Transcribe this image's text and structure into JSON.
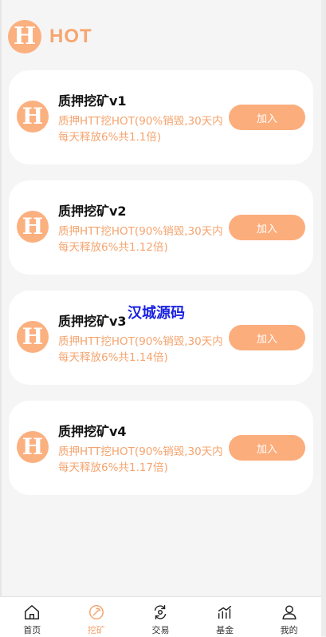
{
  "header": {
    "logo_letter": "H",
    "brand": "HOT"
  },
  "cards": [
    {
      "title": "质押挖矿v1",
      "desc": "质押HTT挖HOT(90%销毁,30天内每天释放6%共1.1倍)",
      "button": "加入"
    },
    {
      "title": "质押挖矿v2",
      "desc": "质押HTT挖HOT(90%销毁,30天内每天释放6%共1.12倍)",
      "button": "加入"
    },
    {
      "title": "质押挖矿v3",
      "desc": "质押HTT挖HOT(90%销毁,30天内每天释放6%共1.14倍)",
      "button": "加入"
    },
    {
      "title": "质押挖矿v4",
      "desc": "质押HTT挖HOT(90%销毁,30天内每天释放6%共1.17倍)",
      "button": "加入"
    }
  ],
  "watermark": "汉城源码",
  "tabbar": [
    {
      "label": "首页",
      "icon": "home-icon"
    },
    {
      "label": "挖矿",
      "icon": "mining-icon",
      "active": true
    },
    {
      "label": "交易",
      "icon": "exchange-icon"
    },
    {
      "label": "基金",
      "icon": "fund-chart-icon"
    },
    {
      "label": "我的",
      "icon": "user-icon"
    }
  ],
  "colors": {
    "accent": "#fbb07f",
    "accent_text": "#f5a46f",
    "background": "#f5f5f5",
    "watermark": "#1a22e0"
  }
}
